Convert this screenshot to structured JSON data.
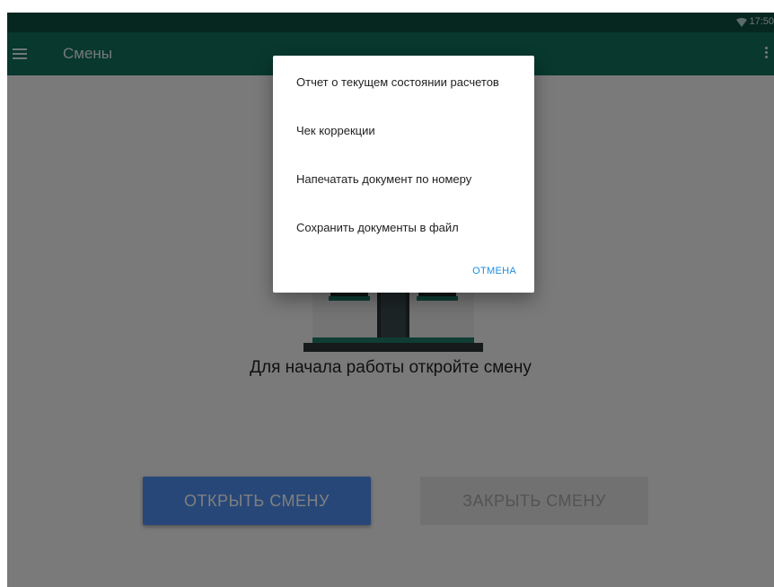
{
  "status_bar": {
    "time": "17:50",
    "icons": [
      "wifi-icon"
    ]
  },
  "app_bar": {
    "title": "Смены",
    "menu_icon": "menu-icon",
    "overflow_icon": "more-vert-icon"
  },
  "main": {
    "illustration": "shop-building-illustration",
    "message": "Для начала работы откройте смену",
    "open_button": "ОТКРЫТЬ СМЕНУ",
    "close_button": "ЗАКРЫТЬ СМЕНУ"
  },
  "dialog": {
    "items": [
      {
        "label": "Отчет о текущем состоянии расчетов"
      },
      {
        "label": "Чек коррекции"
      },
      {
        "label": "Напечатать документ по номеру"
      },
      {
        "label": "Сохранить документы в файл"
      }
    ],
    "cancel_label": "ОТМЕНА"
  },
  "colors": {
    "status_bar": "#0c4e40",
    "app_bar": "#10705c",
    "primary_button": "#4f8ef0",
    "disabled_button": "#e3e3e3",
    "dialog_action": "#1a8fe3"
  }
}
